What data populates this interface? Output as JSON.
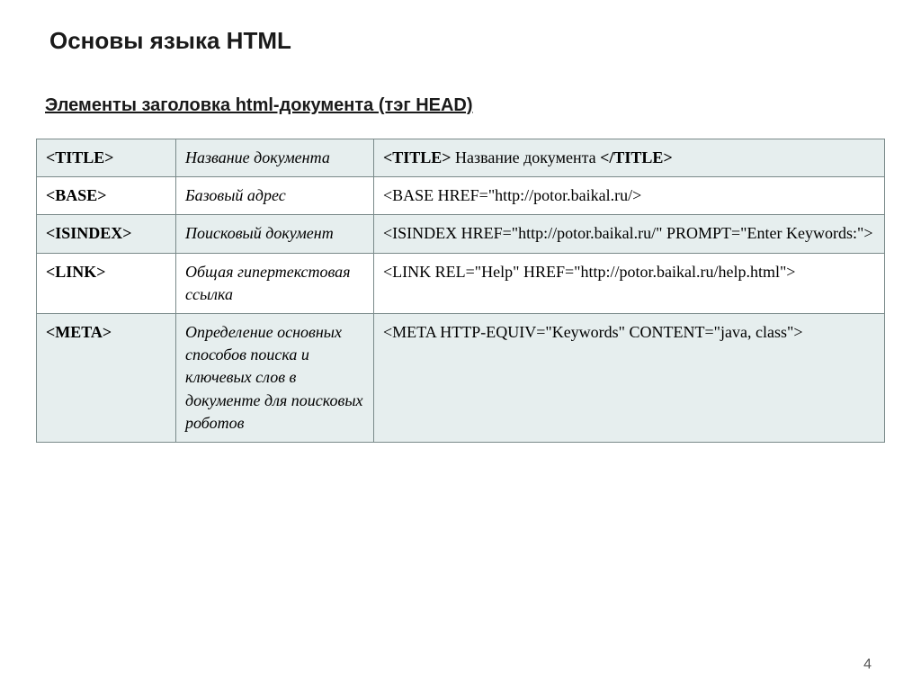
{
  "title": "Основы языка HTML",
  "subtitle": "Элементы заголовка html-документа (тэг HEAD)",
  "rows": [
    {
      "tag": "<TITLE>",
      "desc": "Название документа",
      "example_prefix_bold": "<TITLE>",
      "example_middle": " Название документа ",
      "example_suffix_bold": "</TITLE>",
      "shaded": true
    },
    {
      "tag": "<BASE>",
      "desc": "Базовый адрес",
      "example_plain": "<BASE HREF=\"http://potor.baikal.ru/>",
      "shaded": false
    },
    {
      "tag": "<ISINDEX>",
      "desc": "Поисковый документ",
      "example_plain": "<ISINDEX HREF=\"http://potor.baikal.ru/\" PROMPT=\"Enter Keywords:\">",
      "shaded": true
    },
    {
      "tag": "<LINK>",
      "desc": "Общая гипертекстовая ссылка",
      "example_plain": "<LINK REL=\"Help\" HREF=\"http://potor.baikal.ru/help.html\">",
      "shaded": false
    },
    {
      "tag": "<META>",
      "desc": "Определение основных способов поиска и ключевых слов в документе для поисковых роботов",
      "example_plain": "<META HTTP-EQUIV=\"Keywords\" CONTENT=\"java, class\">",
      "shaded": true
    }
  ],
  "page_number": "4"
}
